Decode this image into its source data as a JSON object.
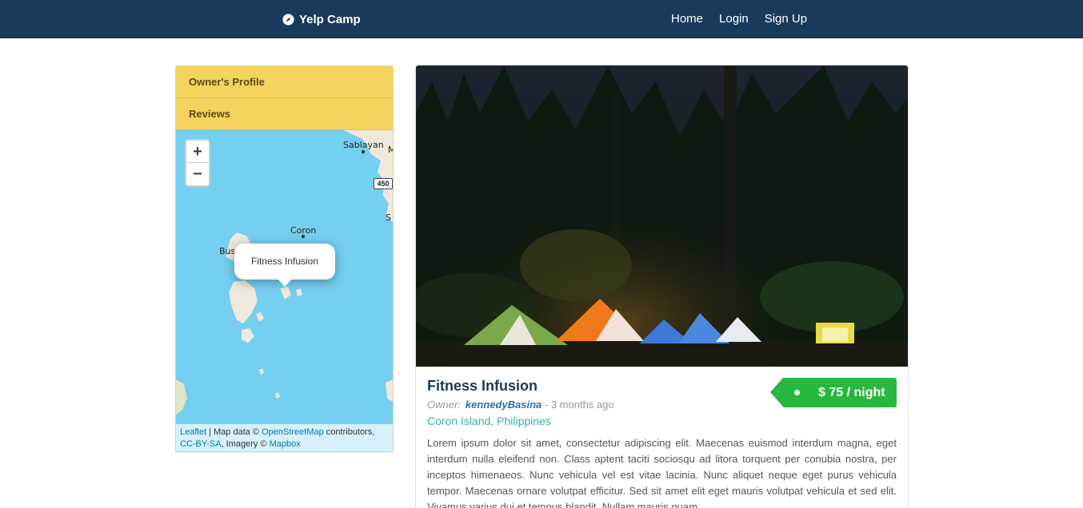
{
  "navbar": {
    "brand": "Yelp Camp",
    "brand_icon": "compass-icon",
    "links": [
      "Home",
      "Login",
      "Sign Up"
    ]
  },
  "sidebar": {
    "items": [
      {
        "label": "Owner's Profile"
      },
      {
        "label": "Reviews"
      }
    ]
  },
  "map": {
    "zoom_in": "+",
    "zoom_out": "−",
    "place_labels": [
      "Sablayan",
      "Coron",
      "Bus",
      "S",
      "M"
    ],
    "road_shield": "450",
    "popup_text": "Fitness Infusion",
    "attribution": {
      "leaflet": "Leaflet",
      "sep": " | Map data © ",
      "osm": "OpenStreetMap",
      "contrib": " contributors,",
      "license": "CC-BY-SA",
      "imagery": ", Imagery © ",
      "mapbox": "Mapbox"
    }
  },
  "campground": {
    "title": "Fitness Infusion",
    "owner_label": "Owner:",
    "owner": "kennedyBasina",
    "posted": " - 3 months ago",
    "location": "Coron Island, Philippines",
    "price": "$ 75 / night",
    "description": "Lorem ipsum dolor sit amet, consectetur adipiscing elit. Maecenas euismod interdum magna, eget interdum nulla eleifend non. Class aptent taciti sociosqu ad litora torquent per conubia nostra, per inceptos himenaeos. Nunc vehicula vel est vitae lacinia. Nunc aliquet neque eget purus vehicula tempor. Maecenas ornare volutpat efficitur. Sed sit amet elit eget mauris volutpat vehicula et sed elit. Vivamus varius dui et tempus blandit. Nullam mauris quam,"
  },
  "colors": {
    "navbar": "#1a3a5c",
    "sidebar_item": "#f4d35e",
    "price_tag": "#27b83f",
    "water": "#75cff0",
    "link": "#2a6fb5",
    "location": "#3bafa6"
  }
}
